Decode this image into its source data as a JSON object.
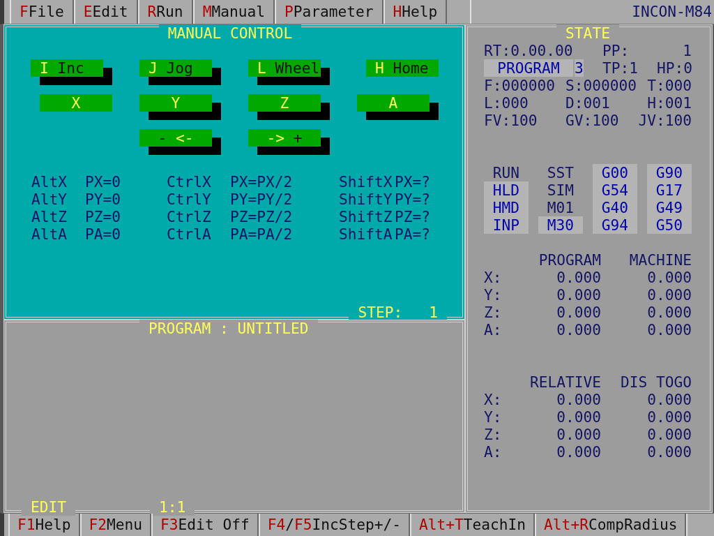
{
  "menu": {
    "items": [
      {
        "parts": [
          {
            "kind": "key",
            "text": "F"
          },
          {
            "kind": "text",
            "text": "File"
          }
        ]
      },
      {
        "parts": [
          {
            "kind": "key",
            "text": "E"
          },
          {
            "kind": "text",
            "text": "Edit"
          }
        ]
      },
      {
        "parts": [
          {
            "kind": "key",
            "text": "R"
          },
          {
            "kind": "text",
            "text": "Run"
          }
        ]
      },
      {
        "parts": [
          {
            "kind": "key",
            "text": "M"
          },
          {
            "kind": "text",
            "text": "Manual"
          }
        ]
      },
      {
        "parts": [
          {
            "kind": "key",
            "text": "P"
          },
          {
            "kind": "text",
            "text": "Parameter"
          }
        ]
      },
      {
        "parts": [
          {
            "kind": "key",
            "text": "H"
          },
          {
            "kind": "text",
            "text": "Help"
          }
        ]
      }
    ],
    "product": "INCON-M84"
  },
  "manual_control": {
    "title": "MANUAL CONTROL",
    "button_rows": [
      {
        "kind": "mode",
        "buttons": [
          {
            "parts": [
              {
                "kind": "key",
                "text": "I"
              },
              {
                "kind": "text",
                "text": "Inc"
              }
            ],
            "selected": false
          },
          {
            "parts": [
              {
                "kind": "key",
                "text": "J"
              },
              {
                "kind": "text",
                "text": "Jog"
              }
            ],
            "selected": false
          },
          {
            "parts": [
              {
                "kind": "key",
                "text": "L"
              },
              {
                "kind": "text",
                "text": "Wheel"
              }
            ],
            "selected": false
          },
          {
            "parts": [
              {
                "kind": "key",
                "text": "H"
              },
              {
                "kind": "text",
                "text": "Home"
              }
            ],
            "selected": true
          }
        ]
      },
      {
        "kind": "axis",
        "buttons": [
          {
            "parts": [
              {
                "kind": "key",
                "text": "X"
              }
            ],
            "selected": true
          },
          {
            "parts": [
              {
                "kind": "key",
                "text": "Y"
              }
            ],
            "selected": false
          },
          {
            "parts": [
              {
                "kind": "key",
                "text": "Z"
              }
            ],
            "selected": false
          },
          {
            "parts": [
              {
                "kind": "key",
                "text": "A"
              }
            ],
            "selected": false
          }
        ]
      },
      {
        "kind": "direction",
        "buttons": [
          {
            "parts": [
              {
                "kind": "text",
                "text": "-"
              },
              {
                "kind": "key",
                "text": "<-"
              }
            ],
            "selected": false
          },
          {
            "parts": [
              {
                "kind": "key",
                "text": "->"
              },
              {
                "kind": "text",
                "text": "+"
              }
            ],
            "selected": false
          }
        ]
      }
    ],
    "shortcuts": [
      [
        {
          "key": "AltX",
          "action": "PX=0"
        },
        {
          "key": "CtrlX",
          "action": "PX=PX/2"
        },
        {
          "key": "ShiftX",
          "action": "PX=?"
        }
      ],
      [
        {
          "key": "AltY",
          "action": "PY=0"
        },
        {
          "key": "CtrlY",
          "action": "PY=PY/2"
        },
        {
          "key": "ShiftY",
          "action": "PY=?"
        }
      ],
      [
        {
          "key": "AltZ",
          "action": "PZ=0"
        },
        {
          "key": "CtrlZ",
          "action": "PZ=PZ/2"
        },
        {
          "key": "ShiftZ",
          "action": "PZ=?"
        }
      ],
      [
        {
          "key": "AltA",
          "action": "PA=0"
        },
        {
          "key": "CtrlA",
          "action": "PA=PA/2"
        },
        {
          "key": "ShiftA",
          "action": "PA=?"
        }
      ]
    ],
    "step": {
      "label": "STEP:",
      "value": "1"
    }
  },
  "program": {
    "title": "PROGRAM : UNTITLED",
    "mode": "EDIT",
    "cursor": "1:1"
  },
  "state": {
    "title": "STATE",
    "rt": "RT:0.00.00",
    "pp_label": "PP:",
    "pp_value": "1",
    "program_label": "PROGRAM",
    "program_number": "3",
    "tp": "TP:1",
    "hp": "HP:0",
    "values": [
      [
        "F:000000",
        "S:000000",
        "T:000"
      ],
      [
        "L:000",
        "D:001",
        "H:001"
      ],
      [
        "FV:100",
        "GV:100",
        "JV:100"
      ]
    ],
    "flags": [
      [
        {
          "text": "RUN",
          "on": false
        },
        {
          "text": "HLD",
          "on": true
        },
        {
          "text": "HMD",
          "on": true
        },
        {
          "text": "INP",
          "on": true
        }
      ],
      [
        {
          "text": "SST",
          "on": false
        },
        {
          "text": "SIM",
          "on": false
        },
        {
          "text": "M01",
          "on": false
        },
        {
          "text": "M30",
          "on": true
        }
      ],
      [
        {
          "text": "G00",
          "on": true
        },
        {
          "text": "G54",
          "on": true
        },
        {
          "text": "G40",
          "on": true
        },
        {
          "text": "G94",
          "on": true
        }
      ],
      [
        {
          "text": "G90",
          "on": true
        },
        {
          "text": "G17",
          "on": true
        },
        {
          "text": "G49",
          "on": true
        },
        {
          "text": "G50",
          "on": true
        }
      ]
    ],
    "positions": [
      {
        "columns": [
          "PROGRAM",
          "MACHINE"
        ],
        "rows": [
          {
            "axis": "X:",
            "values": [
              "0.000",
              "0.000"
            ]
          },
          {
            "axis": "Y:",
            "values": [
              "0.000",
              "0.000"
            ]
          },
          {
            "axis": "Z:",
            "values": [
              "0.000",
              "0.000"
            ]
          },
          {
            "axis": "A:",
            "values": [
              "0.000",
              "0.000"
            ]
          }
        ]
      },
      {
        "columns": [
          "RELATIVE",
          "DIS TOGO"
        ],
        "rows": [
          {
            "axis": "X:",
            "values": [
              "0.000",
              "0.000"
            ]
          },
          {
            "axis": "Y:",
            "values": [
              "0.000",
              "0.000"
            ]
          },
          {
            "axis": "Z:",
            "values": [
              "0.000",
              "0.000"
            ]
          },
          {
            "axis": "A:",
            "values": [
              "0.000",
              "0.000"
            ]
          }
        ]
      }
    ]
  },
  "function_keys": [
    {
      "parts": [
        {
          "kind": "key",
          "text": "F1"
        },
        {
          "kind": "text",
          "text": "Help"
        }
      ]
    },
    {
      "parts": [
        {
          "kind": "key",
          "text": "F2"
        },
        {
          "kind": "text",
          "text": "Menu"
        }
      ]
    },
    {
      "parts": [
        {
          "kind": "key",
          "text": "F3"
        },
        {
          "kind": "text",
          "text": "Edit Off"
        }
      ]
    },
    {
      "parts": [
        {
          "kind": "key",
          "text": "F4"
        },
        {
          "kind": "text",
          "text": "/"
        },
        {
          "kind": "key",
          "text": "F5"
        },
        {
          "kind": "text",
          "text": "IncStep+/-"
        }
      ]
    },
    {
      "parts": [
        {
          "kind": "key",
          "text": "Alt+T"
        },
        {
          "kind": "text",
          "text": "TeachIn"
        }
      ]
    },
    {
      "parts": [
        {
          "kind": "key",
          "text": "Alt+R"
        },
        {
          "kind": "text",
          "text": "CompRadius"
        }
      ]
    }
  ]
}
